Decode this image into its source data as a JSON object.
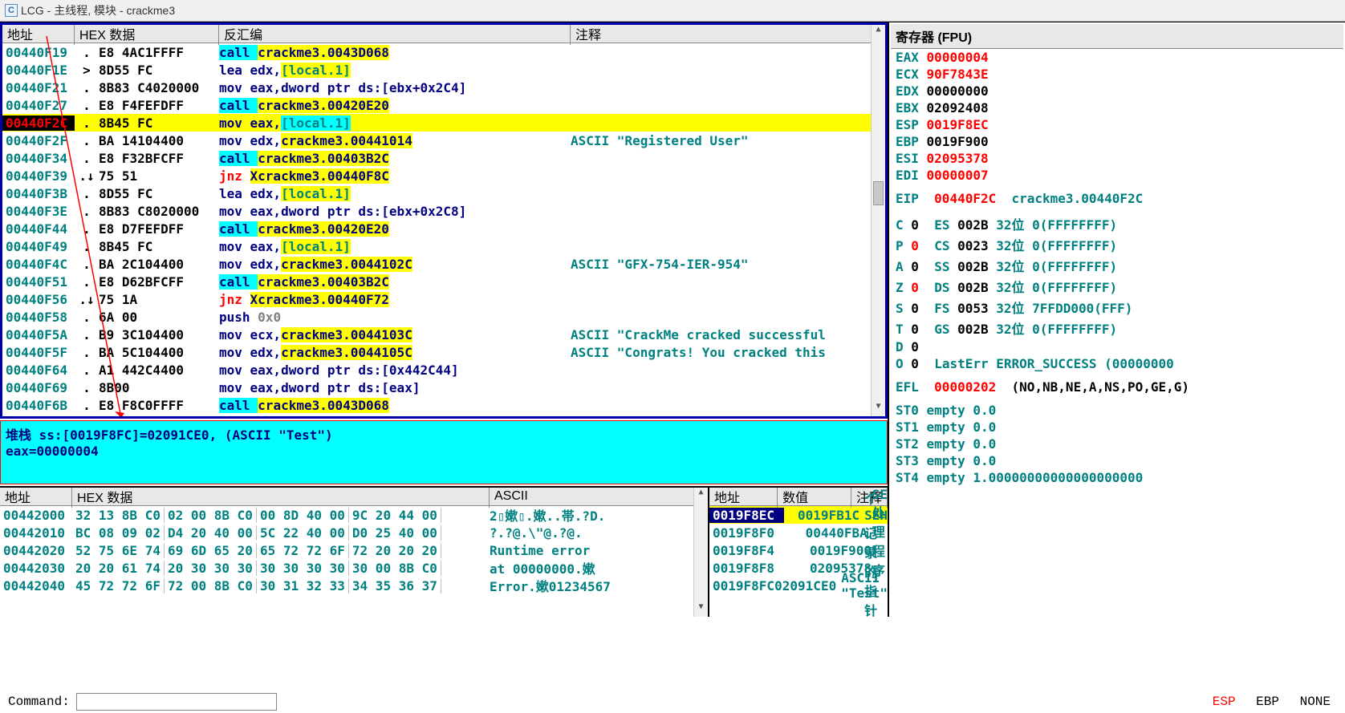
{
  "title": "LCG - 主线程, 模块 - crackme3",
  "disasm": {
    "headers": [
      "地址",
      "HEX 数据",
      "反汇编",
      "注释"
    ],
    "rows": [
      {
        "addr": "00440F19",
        "mark": ".",
        "hex": "E8 4AC1FFFF",
        "asm": [
          {
            "t": "call ",
            "c": "navy",
            "bg": "cyan"
          },
          {
            "t": "crackme3.0043D068",
            "c": "navy",
            "bg": "yellow"
          }
        ],
        "cmt": ""
      },
      {
        "addr": "00440F1E",
        "mark": ">",
        "hex": "8D55 FC",
        "asm": [
          {
            "t": "lea edx,",
            "c": "navy"
          },
          {
            "t": "[local.1]",
            "c": "teal",
            "bg": "yellow"
          }
        ],
        "cmt": ""
      },
      {
        "addr": "00440F21",
        "mark": ".",
        "hex": "8B83 C4020000",
        "asm": [
          {
            "t": "mov eax,dword ptr ds:[ebx+0x2C4]",
            "c": "navy"
          }
        ],
        "cmt": ""
      },
      {
        "addr": "00440F27",
        "mark": ".",
        "hex": "E8 F4FEFDFF",
        "asm": [
          {
            "t": "call ",
            "c": "navy",
            "bg": "cyan"
          },
          {
            "t": "crackme3.00420E20",
            "c": "navy",
            "bg": "yellow"
          }
        ],
        "cmt": ""
      },
      {
        "addr": "00440F2C",
        "mark": ".",
        "hex": "8B45 FC",
        "asm": [
          {
            "t": "mov eax,",
            "c": "navy"
          },
          {
            "t": "[local.1]",
            "c": "teal",
            "bg": "cyan"
          }
        ],
        "cmt": "",
        "sel": true
      },
      {
        "addr": "00440F2F",
        "mark": ".",
        "hex": "BA 14104400",
        "asm": [
          {
            "t": "mov edx,",
            "c": "navy"
          },
          {
            "t": "crackme3.00441014",
            "c": "navy",
            "bg": "yellow"
          }
        ],
        "cmt": "ASCII \"Registered User\""
      },
      {
        "addr": "00440F34",
        "mark": ".",
        "hex": "E8 F32BFCFF",
        "asm": [
          {
            "t": "call ",
            "c": "navy",
            "bg": "cyan"
          },
          {
            "t": "crackme3.00403B2C",
            "c": "navy",
            "bg": "yellow"
          }
        ],
        "cmt": ""
      },
      {
        "addr": "00440F39",
        "mark": ".↓",
        "hex": "75 51",
        "asm": [
          {
            "t": "jnz ",
            "c": "red"
          },
          {
            "t": "Xcrackme3.00440F8C",
            "c": "navy",
            "bg": "yellow"
          }
        ],
        "cmt": ""
      },
      {
        "addr": "00440F3B",
        "mark": ".",
        "hex": "8D55 FC",
        "asm": [
          {
            "t": "lea edx,",
            "c": "navy"
          },
          {
            "t": "[local.1]",
            "c": "teal",
            "bg": "yellow"
          }
        ],
        "cmt": ""
      },
      {
        "addr": "00440F3E",
        "mark": ".",
        "hex": "8B83 C8020000",
        "asm": [
          {
            "t": "mov eax,dword ptr ds:[ebx+0x2C8]",
            "c": "navy"
          }
        ],
        "cmt": ""
      },
      {
        "addr": "00440F44",
        "mark": ".",
        "hex": "E8 D7FEFDFF",
        "asm": [
          {
            "t": "call ",
            "c": "navy",
            "bg": "cyan"
          },
          {
            "t": "crackme3.00420E20",
            "c": "navy",
            "bg": "yellow"
          }
        ],
        "cmt": ""
      },
      {
        "addr": "00440F49",
        "mark": ".",
        "hex": "8B45 FC",
        "asm": [
          {
            "t": "mov eax,",
            "c": "navy"
          },
          {
            "t": "[local.1]",
            "c": "teal",
            "bg": "yellow"
          }
        ],
        "cmt": ""
      },
      {
        "addr": "00440F4C",
        "mark": ".",
        "hex": "BA 2C104400",
        "asm": [
          {
            "t": "mov edx,",
            "c": "navy"
          },
          {
            "t": "crackme3.0044102C",
            "c": "navy",
            "bg": "yellow"
          }
        ],
        "cmt": "ASCII \"GFX-754-IER-954\""
      },
      {
        "addr": "00440F51",
        "mark": ".",
        "hex": "E8 D62BFCFF",
        "asm": [
          {
            "t": "call ",
            "c": "navy",
            "bg": "cyan"
          },
          {
            "t": "crackme3.00403B2C",
            "c": "navy",
            "bg": "yellow"
          }
        ],
        "cmt": ""
      },
      {
        "addr": "00440F56",
        "mark": ".↓",
        "hex": "75 1A",
        "asm": [
          {
            "t": "jnz ",
            "c": "red"
          },
          {
            "t": "Xcrackme3.00440F72",
            "c": "navy",
            "bg": "yellow"
          }
        ],
        "cmt": ""
      },
      {
        "addr": "00440F58",
        "mark": ".",
        "hex": "6A 00",
        "asm": [
          {
            "t": "push ",
            "c": "navy"
          },
          {
            "t": "0x0",
            "c": "gray"
          }
        ],
        "cmt": ""
      },
      {
        "addr": "00440F5A",
        "mark": ".",
        "hex": "B9 3C104400",
        "asm": [
          {
            "t": "mov ecx,",
            "c": "navy"
          },
          {
            "t": "crackme3.0044103C",
            "c": "navy",
            "bg": "yellow"
          }
        ],
        "cmt": "ASCII \"CrackMe cracked successful"
      },
      {
        "addr": "00440F5F",
        "mark": ".",
        "hex": "BA 5C104400",
        "asm": [
          {
            "t": "mov edx,",
            "c": "navy"
          },
          {
            "t": "crackme3.0044105C",
            "c": "navy",
            "bg": "yellow"
          }
        ],
        "cmt": "ASCII \"Congrats! You cracked this"
      },
      {
        "addr": "00440F64",
        "mark": ".",
        "hex": "A1 442C4400",
        "asm": [
          {
            "t": "mov eax,dword ptr ds:[0x442C44]",
            "c": "navy"
          }
        ],
        "cmt": ""
      },
      {
        "addr": "00440F69",
        "mark": ".",
        "hex": "8B00",
        "asm": [
          {
            "t": "mov eax,dword ptr ds:[eax]",
            "c": "navy"
          }
        ],
        "cmt": ""
      },
      {
        "addr": "00440F6B",
        "mark": ".",
        "hex": "E8 F8C0FFFF",
        "asm": [
          {
            "t": "call ",
            "c": "navy",
            "bg": "cyan"
          },
          {
            "t": "crackme3.0043D068",
            "c": "navy",
            "bg": "yellow"
          }
        ],
        "cmt": ""
      }
    ]
  },
  "info": {
    "line1": "堆栈 ss:[0019F8FC]=02091CE0, (ASCII \"Test\")",
    "line2": "eax=00000004"
  },
  "dump": {
    "headers": [
      "地址",
      "HEX 数据",
      "ASCII"
    ],
    "rows": [
      {
        "addr": "00442000",
        "hex": [
          "32 13 8B C0",
          "02 00 8B C0",
          "00 8D 40 00",
          "9C 20 44 00"
        ],
        "asc": "2▯嫰▯.嫰..帯.?D."
      },
      {
        "addr": "00442010",
        "hex": [
          "BC 08 09 02",
          "D4 20 40 00",
          "5C 22 40 00",
          "D0 25 40 00"
        ],
        "asc": "?.?@.\\\"@.?@."
      },
      {
        "addr": "00442020",
        "hex": [
          "52 75 6E 74",
          "69 6D 65 20",
          "65 72 72 6F",
          "72 20 20 20"
        ],
        "asc": "Runtime error   "
      },
      {
        "addr": "00442030",
        "hex": [
          "20 20 61 74",
          "20 30 30 30",
          "30 30 30 30",
          "30 00 8B C0"
        ],
        "asc": "  at 00000000.嫰"
      },
      {
        "addr": "00442040",
        "hex": [
          "45 72 72 6F",
          "72 00 8B C0",
          "30 31 32 33",
          "34 35 36 37"
        ],
        "asc": "Error.嫰01234567"
      }
    ]
  },
  "stack": {
    "headers": [
      "地址",
      "数值",
      "注释"
    ],
    "rows": [
      {
        "addr": "0019F8EC",
        "val": "0019FB1C",
        "cmt": "指向下一个 SEH 记录的指针",
        "sel": true
      },
      {
        "addr": "0019F8F0",
        "val": "00440FBA",
        "cmt": "SE处理程序"
      },
      {
        "addr": "0019F8F4",
        "val": "0019F900",
        "cmt": ""
      },
      {
        "addr": "0019F8F8",
        "val": "02095378",
        "cmt": ""
      },
      {
        "addr": "0019F8FC",
        "val": "02091CE0",
        "cmt": "ASCII \"Test\""
      }
    ]
  },
  "registers": {
    "header": "寄存器 (FPU)",
    "gp": [
      {
        "n": "EAX",
        "v": "00000004",
        "red": true
      },
      {
        "n": "ECX",
        "v": "90F7843E",
        "red": true
      },
      {
        "n": "EDX",
        "v": "00000000",
        "red": false
      },
      {
        "n": "EBX",
        "v": "02092408",
        "red": false
      },
      {
        "n": "ESP",
        "v": "0019F8EC",
        "red": true
      },
      {
        "n": "EBP",
        "v": "0019F900",
        "red": false
      },
      {
        "n": "ESI",
        "v": "02095378",
        "red": true
      },
      {
        "n": "EDI",
        "v": "00000007",
        "red": true
      }
    ],
    "eip": {
      "n": "EIP",
      "v": "00440F2C",
      "ext": "crackme3.00440F2C"
    },
    "flags": [
      {
        "f": "C",
        "v": "0",
        "seg": "ES",
        "sv": "002B",
        "ext": "32位 0(FFFFFFFF)"
      },
      {
        "f": "P",
        "v": "0",
        "vr": true,
        "seg": "CS",
        "sv": "0023",
        "ext": "32位 0(FFFFFFFF)"
      },
      {
        "f": "A",
        "v": "0",
        "seg": "SS",
        "sv": "002B",
        "ext": "32位 0(FFFFFFFF)"
      },
      {
        "f": "Z",
        "v": "0",
        "vr": true,
        "seg": "DS",
        "sv": "002B",
        "ext": "32位 0(FFFFFFFF)"
      },
      {
        "f": "S",
        "v": "0",
        "seg": "FS",
        "sv": "0053",
        "ext": "32位 7FFDD000(FFF)"
      },
      {
        "f": "T",
        "v": "0",
        "seg": "GS",
        "sv": "002B",
        "ext": "32位 0(FFFFFFFF)"
      },
      {
        "f": "D",
        "v": "0"
      },
      {
        "f": "O",
        "v": "0",
        "lasterr": "LastErr ERROR_SUCCESS (00000000"
      }
    ],
    "efl": {
      "n": "EFL",
      "v": "00000202",
      "ext": "(NO,NB,NE,A,NS,PO,GE,G)"
    },
    "fpu": [
      "ST0 empty 0.0",
      "ST1 empty 0.0",
      "ST2 empty 0.0",
      "ST3 empty 0.0",
      "ST4 empty 1.00000000000000000000"
    ]
  },
  "cmdbar": {
    "label": "Command:",
    "placeholder": "",
    "esp": "ESP",
    "ebp": "EBP",
    "none": "NONE"
  }
}
